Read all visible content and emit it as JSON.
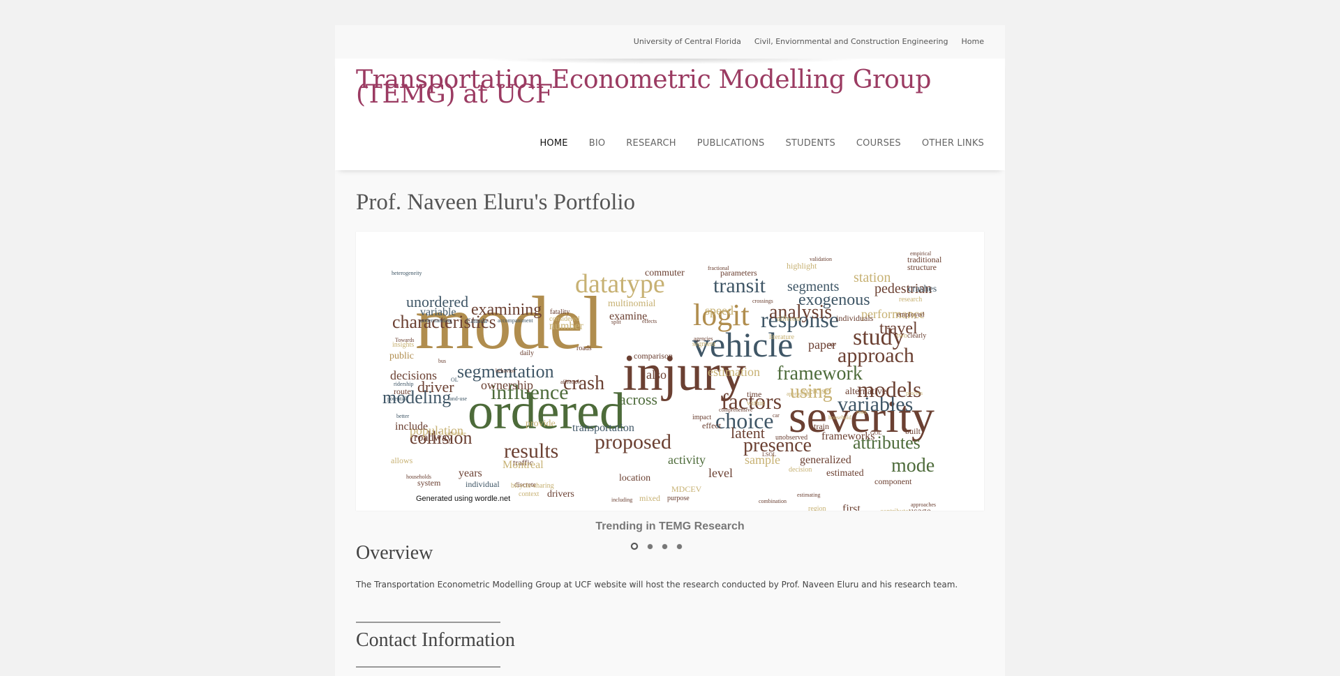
{
  "top_links": [
    "University of Central Florida",
    "Civil, Enviornmental and Construction Engineering",
    "Home"
  ],
  "site_title": "Transportation Econometric Modelling Group (TEMG) at UCF",
  "nav": [
    {
      "label": "HOME",
      "active": true
    },
    {
      "label": "BIO",
      "active": false
    },
    {
      "label": "RESEARCH",
      "active": false
    },
    {
      "label": "PUBLICATIONS",
      "active": false
    },
    {
      "label": "STUDENTS",
      "active": false
    },
    {
      "label": "COURSES",
      "active": false
    },
    {
      "label": "OTHER LINKS",
      "active": false
    }
  ],
  "page_heading": "Prof. Naveen Eluru's Portfolio",
  "slider": {
    "image_words": [
      "model",
      "injury",
      "ordered",
      "severity",
      "vehicle",
      "datatype",
      "transit",
      "logit",
      "response",
      "study",
      "approach",
      "factors",
      "variables",
      "models",
      "segmentation",
      "influence",
      "crash",
      "modeling",
      "proposed",
      "results",
      "choice",
      "presence",
      "attributes",
      "mode",
      "framework",
      "using",
      "analysis",
      "exogenous",
      "segments",
      "pedestrian",
      "travel",
      "performance",
      "station",
      "characteristics",
      "examining",
      "unordered",
      "driver",
      "ownership",
      "collision",
      "population",
      "decisions",
      "include",
      "estimation",
      "latent",
      "activity",
      "sample",
      "generalized",
      "estimated",
      "level",
      "speed",
      "number",
      "commuter",
      "transportation",
      "across",
      "also",
      "paper",
      "traditional",
      "structure",
      "crashes",
      "highlight",
      "parameters",
      "heterogeneity",
      "variable",
      "fatality",
      "multinomial",
      "examine",
      "considered",
      "public",
      "insights",
      "daily",
      "roads",
      "comparison",
      "individual",
      "system",
      "years",
      "discrete",
      "drivers",
      "location",
      "MDCEV",
      "mixed",
      "purpose",
      "first",
      "current",
      "usage",
      "region",
      "contributes",
      "component",
      "frameworks",
      "unobserved",
      "train",
      "alternative",
      "exercise",
      "time",
      "within",
      "effect",
      "impact",
      "traffic",
      "Montreal",
      "bicycle-sharing",
      "context",
      "households",
      "allows",
      "roadway",
      "provide",
      "route",
      "ridership",
      "Canada",
      "understanding",
      "accompaniment",
      "different",
      "individuals",
      "employed",
      "clearly",
      "two",
      "segment",
      "agencies",
      "literature",
      "empirical",
      "validation",
      "fractional",
      "crossings",
      "research",
      "Towards",
      "bus",
      "OL",
      "affect",
      "role",
      "decision",
      "LSOL",
      "GOL",
      "built",
      "process",
      "appropriate",
      "better",
      "commute",
      "land-use",
      "potential",
      "including",
      "estimating",
      "combination",
      "approaches",
      "comprehensive",
      "car",
      "road",
      "household",
      "effects",
      "split",
      "age",
      "behavior"
    ],
    "credit": "Generated using wordle.net",
    "caption": "Trending in TEMG Research",
    "slide_count": 4,
    "active_slide": 1
  },
  "overview": {
    "heading": "Overview",
    "text": "The Transportation Econometric Modelling Group at UCF website will host the research conducted by Prof. Naveen Eluru and his research team."
  },
  "contact": {
    "heading": "Contact Information"
  },
  "colors": {
    "title": "#9b3b62",
    "word_gold": "#b08d4e",
    "word_brown": "#6b4032",
    "word_green": "#4d6b3a",
    "word_slate": "#3f5666",
    "word_tan": "#c7b173"
  }
}
